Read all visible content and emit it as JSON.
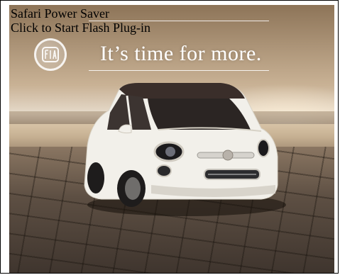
{
  "plugin_notice": {
    "title": "Safari Power Saver",
    "action": "Click to Start Flash Plug-in"
  },
  "ad": {
    "tagline": "It’s time for more.",
    "car_color": "#f2f0ea"
  }
}
